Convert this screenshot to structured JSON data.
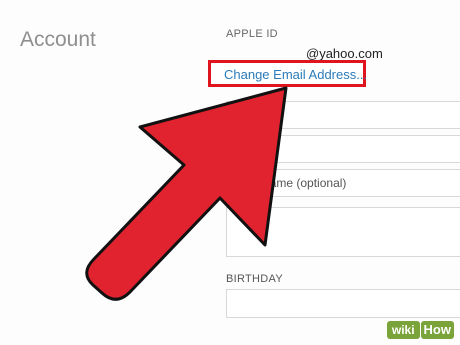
{
  "header": {
    "title": "Account"
  },
  "apple_id": {
    "label": "APPLE ID",
    "email": "@yahoo.com",
    "change_email_link": "Change Email Address..."
  },
  "fields": {
    "middle_name_placeholder": "ddle name (optional)"
  },
  "birthday": {
    "label": "BIRTHDAY"
  },
  "annotation": {
    "arrow_color": "#e0232e",
    "highlight_color": "#e0141e"
  },
  "watermark": {
    "prefix": "wiki",
    "suffix": "How",
    "brand_color": "#7aa33a"
  }
}
